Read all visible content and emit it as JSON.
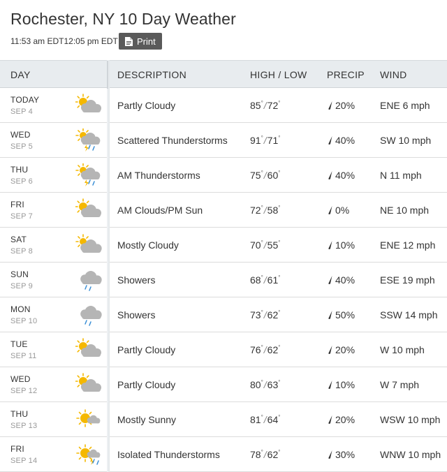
{
  "header": {
    "title": "Rochester, NY 10 Day Weather",
    "timestamps": "11:53 am EDT12:05 pm EDT",
    "print_label": "Print"
  },
  "columns": {
    "day": "DAY",
    "description": "DESCRIPTION",
    "high_low": "HIGH / LOW",
    "precip": "PRECIP",
    "wind": "WIND"
  },
  "rows": [
    {
      "day": "TODAY",
      "date": "SEP 4",
      "icon": "partly-cloudy-icon",
      "desc": "Partly Cloudy",
      "high": "85",
      "low": "72",
      "precip": "20%",
      "wind": "ENE 6 mph"
    },
    {
      "day": "WED",
      "date": "SEP 5",
      "icon": "thunderstorm-icon",
      "desc": "Scattered Thunderstorms",
      "high": "91",
      "low": "71",
      "precip": "40%",
      "wind": "SW 10 mph"
    },
    {
      "day": "THU",
      "date": "SEP 6",
      "icon": "thunderstorm-icon",
      "desc": "AM Thunderstorms",
      "high": "75",
      "low": "60",
      "precip": "40%",
      "wind": "N 11 mph"
    },
    {
      "day": "FRI",
      "date": "SEP 7",
      "icon": "partly-cloudy-icon",
      "desc": "AM Clouds/PM Sun",
      "high": "72",
      "low": "58",
      "precip": "0%",
      "wind": "NE 10 mph"
    },
    {
      "day": "SAT",
      "date": "SEP 8",
      "icon": "mostly-cloudy-icon",
      "desc": "Mostly Cloudy",
      "high": "70",
      "low": "55",
      "precip": "10%",
      "wind": "ENE 12 mph"
    },
    {
      "day": "SUN",
      "date": "SEP 9",
      "icon": "showers-icon",
      "desc": "Showers",
      "high": "68",
      "low": "61",
      "precip": "40%",
      "wind": "ESE 19 mph"
    },
    {
      "day": "MON",
      "date": "SEP 10",
      "icon": "showers-icon",
      "desc": "Showers",
      "high": "73",
      "low": "62",
      "precip": "50%",
      "wind": "SSW 14 mph"
    },
    {
      "day": "TUE",
      "date": "SEP 11",
      "icon": "partly-cloudy-icon",
      "desc": "Partly Cloudy",
      "high": "76",
      "low": "62",
      "precip": "20%",
      "wind": "W 10 mph"
    },
    {
      "day": "WED",
      "date": "SEP 12",
      "icon": "partly-cloudy-icon",
      "desc": "Partly Cloudy",
      "high": "80",
      "low": "63",
      "precip": "10%",
      "wind": "W 7 mph"
    },
    {
      "day": "THU",
      "date": "SEP 13",
      "icon": "mostly-sunny-icon",
      "desc": "Mostly Sunny",
      "high": "81",
      "low": "64",
      "precip": "20%",
      "wind": "WSW 10 mph"
    },
    {
      "day": "FRI",
      "date": "SEP 14",
      "icon": "sun-thunder-icon",
      "desc": "Isolated Thunderstorms",
      "high": "78",
      "low": "62",
      "precip": "30%",
      "wind": "WNW 10 mph"
    }
  ],
  "colors": {
    "sun": "#f5b800",
    "cloud": "#b5b5b5",
    "rain": "#3a8fd6",
    "lightning": "#f5b800",
    "header_bg": "#e8ecef",
    "print_bg": "#5a5a5a",
    "date_text": "#999999"
  }
}
